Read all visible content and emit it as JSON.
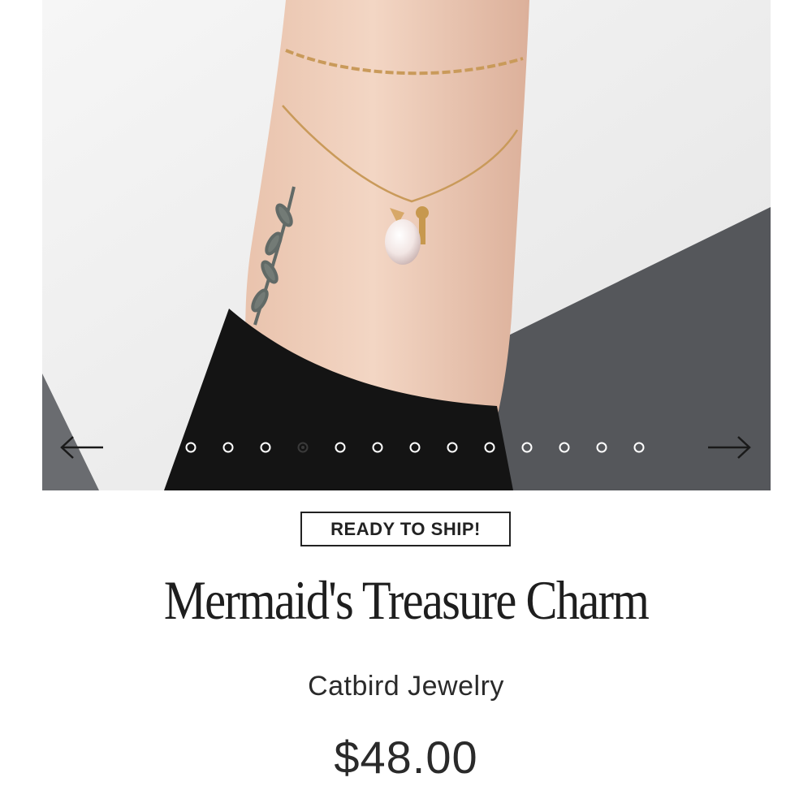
{
  "product": {
    "badge": "READY TO SHIP!",
    "title": "Mermaid's Treasure Charm",
    "brand": "Catbird Jewelry",
    "price": "$48.00"
  },
  "carousel": {
    "prev_icon": "arrow-left-icon",
    "next_icon": "arrow-right-icon",
    "slide_count": 13,
    "active_index": 3
  },
  "colors": {
    "text": "#222222",
    "dot": "#ffffff",
    "dot_active": "#3a3a3a"
  }
}
